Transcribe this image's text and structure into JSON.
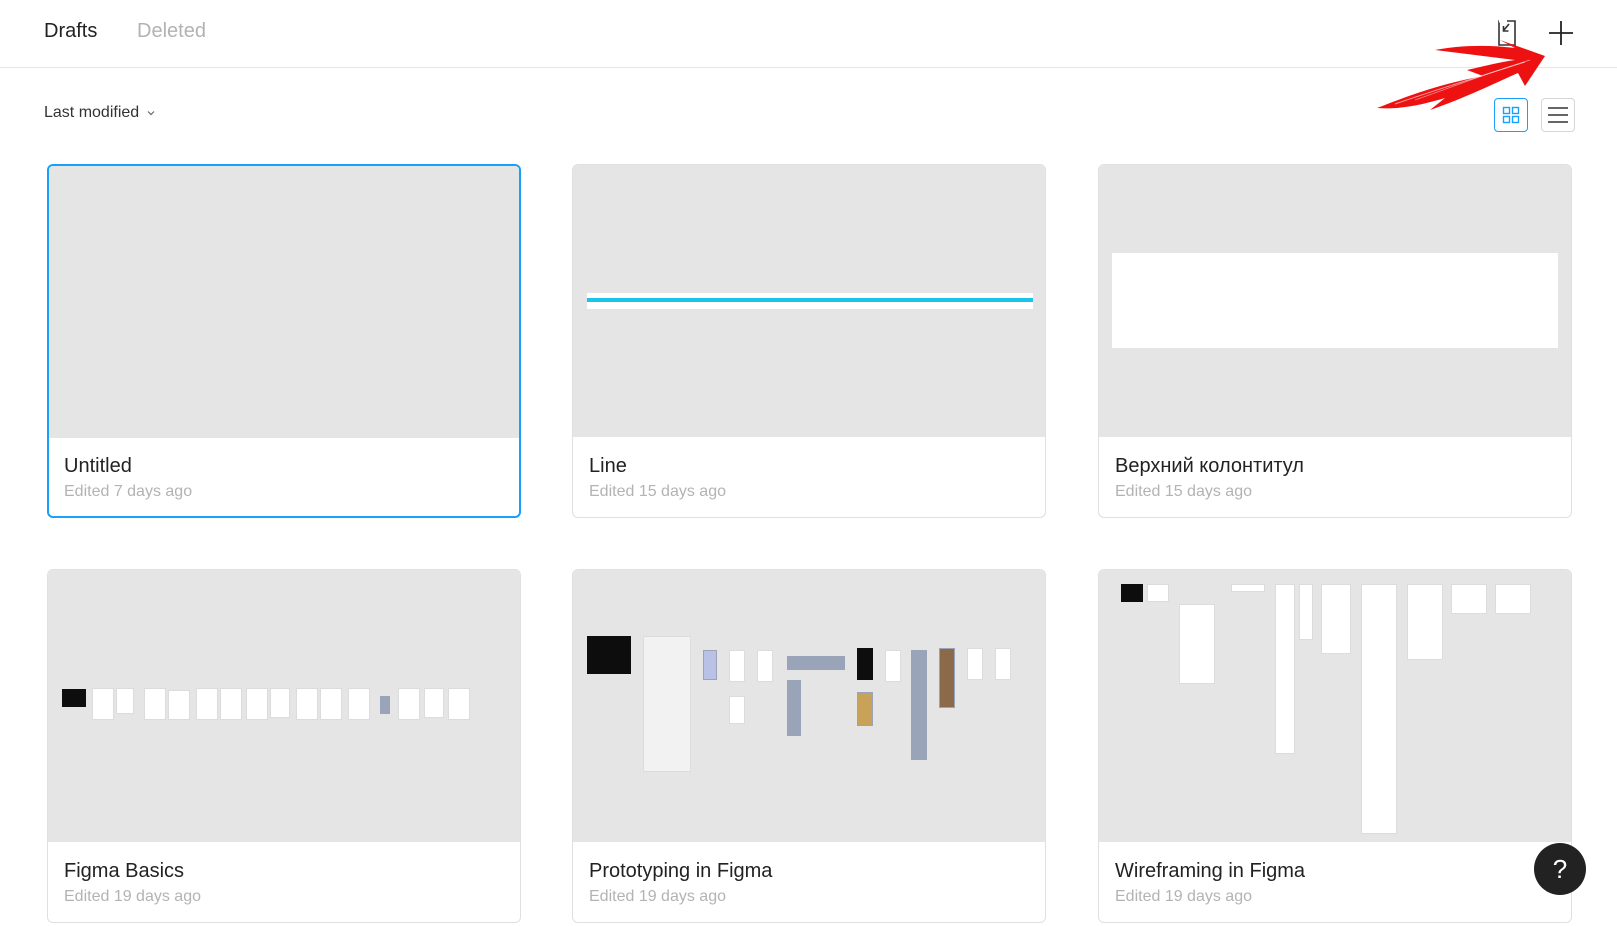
{
  "header": {
    "tabs": [
      {
        "label": "Drafts",
        "active": true
      },
      {
        "label": "Deleted",
        "active": false
      }
    ],
    "import_icon": "import-file-icon",
    "new_icon": "plus-icon"
  },
  "toolbar": {
    "sort_label": "Last modified",
    "sort_icon": "chevron-down-icon",
    "view_modes": [
      {
        "icon": "grid-view-icon",
        "active": true
      },
      {
        "icon": "list-view-icon",
        "active": false
      }
    ],
    "accent_color": "#18a0fb"
  },
  "files": [
    {
      "title": "Untitled",
      "edited": "Edited 7 days ago",
      "selected": true
    },
    {
      "title": "Line",
      "edited": "Edited 15 days ago",
      "selected": false
    },
    {
      "title": "Верхний колонтитул",
      "edited": "Edited 15 days ago",
      "selected": false
    },
    {
      "title": "Figma Basics",
      "edited": "Edited 19 days ago",
      "selected": false
    },
    {
      "title": "Prototyping in Figma",
      "edited": "Edited 19 days ago",
      "selected": false
    },
    {
      "title": "Wireframing in Figma",
      "edited": "Edited 19 days ago",
      "selected": false
    }
  ],
  "help": {
    "label": "?"
  },
  "annotation": {
    "icon": "red-arrow-annotation",
    "color": "#ee1111"
  }
}
